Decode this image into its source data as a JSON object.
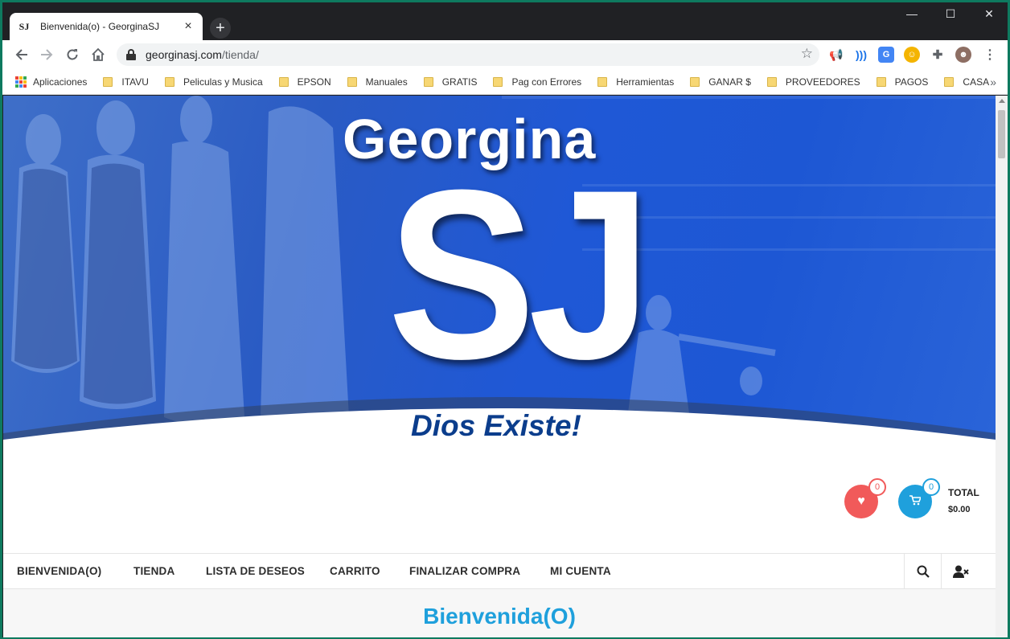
{
  "browser": {
    "tab_title": "Bienvenida(o) - GeorginaSJ",
    "tab_favicon_text": "SJ",
    "url_host": "georginasj.com",
    "url_path": "/tienda/"
  },
  "bookmarks": [
    {
      "label": "Aplicaciones",
      "icon": "apps-grid-icon"
    },
    {
      "label": "ITAVU",
      "icon": "folder-icon"
    },
    {
      "label": "Peliculas y Musica",
      "icon": "folder-icon"
    },
    {
      "label": "EPSON",
      "icon": "folder-icon"
    },
    {
      "label": "Manuales",
      "icon": "folder-icon"
    },
    {
      "label": "GRATIS",
      "icon": "folder-icon"
    },
    {
      "label": "Pag con Errores",
      "icon": "folder-icon"
    },
    {
      "label": "Herramientas",
      "icon": "folder-icon"
    },
    {
      "label": "GANAR $",
      "icon": "folder-icon"
    },
    {
      "label": "PROVEEDORES",
      "icon": "folder-icon"
    },
    {
      "label": "PAGOS",
      "icon": "folder-icon"
    },
    {
      "label": "CASA",
      "icon": "folder-icon"
    }
  ],
  "hero": {
    "brand_top": "Georgina",
    "brand_main": "SJ",
    "tagline": "Dios Existe!"
  },
  "header": {
    "wishlist_count": "0",
    "cart_count": "0",
    "total_label": "TOTAL",
    "total_value": "$0.00"
  },
  "menu": {
    "items": [
      {
        "label": "BIENVENIDA(O)"
      },
      {
        "label": "TIENDA"
      },
      {
        "label": "LISTA DE DESEOS"
      },
      {
        "label": "CARRITO"
      },
      {
        "label": "FINALIZAR COMPRA"
      },
      {
        "label": "MI CUENTA"
      }
    ]
  },
  "page": {
    "heading": "Bienvenida(O)"
  },
  "colors": {
    "accent": "#1fa0dc",
    "wishlist": "#f15a5a",
    "hero_blue": "#1f58d6",
    "tagline": "#0b3d8c"
  }
}
